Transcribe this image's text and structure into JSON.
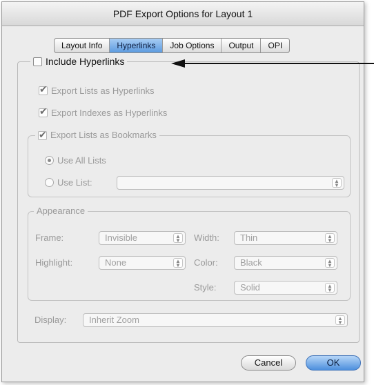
{
  "window": {
    "title": "PDF Export Options for Layout 1"
  },
  "tabs": [
    {
      "label": "Layout Info",
      "active": false
    },
    {
      "label": "Hyperlinks",
      "active": true
    },
    {
      "label": "Job Options",
      "active": false
    },
    {
      "label": "Output",
      "active": false
    },
    {
      "label": "OPI",
      "active": false
    }
  ],
  "hyperlinks": {
    "include_label": "Include Hyperlinks",
    "include_checked": false,
    "export_lists_label": "Export Lists as Hyperlinks",
    "export_lists_checked": true,
    "export_indexes_label": "Export Indexes as Hyperlinks",
    "export_indexes_checked": true,
    "bookmarks": {
      "label": "Export Lists as Bookmarks",
      "checked": true,
      "use_all_lists_label": "Use All Lists",
      "use_all_lists_selected": true,
      "use_list_label": "Use List:",
      "use_list_value": ""
    },
    "appearance": {
      "legend": "Appearance",
      "frame_label": "Frame:",
      "frame_value": "Invisible",
      "width_label": "Width:",
      "width_value": "Thin",
      "highlight_label": "Highlight:",
      "highlight_value": "None",
      "color_label": "Color:",
      "color_value": "Black",
      "style_label": "Style:",
      "style_value": "Solid"
    },
    "display_label": "Display:",
    "display_value": "Inherit Zoom"
  },
  "buttons": {
    "cancel": "Cancel",
    "ok": "OK"
  },
  "colors": {
    "accent": "#5d9be0",
    "dialog_bg": "#ececec"
  }
}
